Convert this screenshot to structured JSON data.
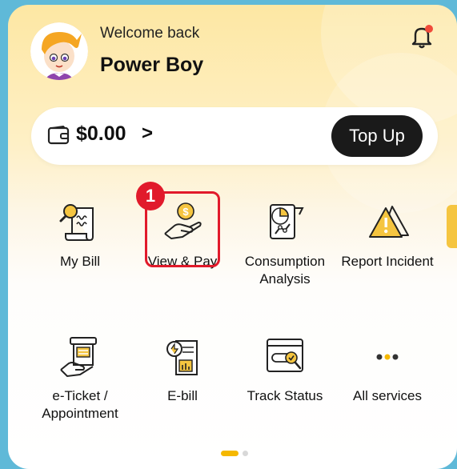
{
  "header": {
    "welcome_text": "Welcome back",
    "user_name": "Power Boy",
    "notification_dot": true
  },
  "wallet": {
    "balance": "$0.00",
    "chevron": ">",
    "top_up_label": "Top Up"
  },
  "services": [
    {
      "label": "My Bill",
      "icon": "bill-magnifier-icon"
    },
    {
      "label": "View & Pay",
      "icon": "hand-coin-icon",
      "highlighted": true,
      "badge": "1"
    },
    {
      "label": "Consumption Analysis",
      "icon": "analysis-chart-icon"
    },
    {
      "label": "Report Incident",
      "icon": "warning-triangle-icon"
    },
    {
      "label": "e-Ticket / Appointment",
      "icon": "ticket-hand-icon"
    },
    {
      "label": "E-bill",
      "icon": "ebill-icon"
    },
    {
      "label": "Track Status",
      "icon": "track-status-icon"
    },
    {
      "label": "All services",
      "icon": "more-dots-icon"
    }
  ],
  "pagination": {
    "total_pages": 2,
    "current_page": 1
  },
  "colors": {
    "accent": "#f5b800",
    "highlight": "#e11a2b",
    "dark": "#1a1a1a"
  }
}
